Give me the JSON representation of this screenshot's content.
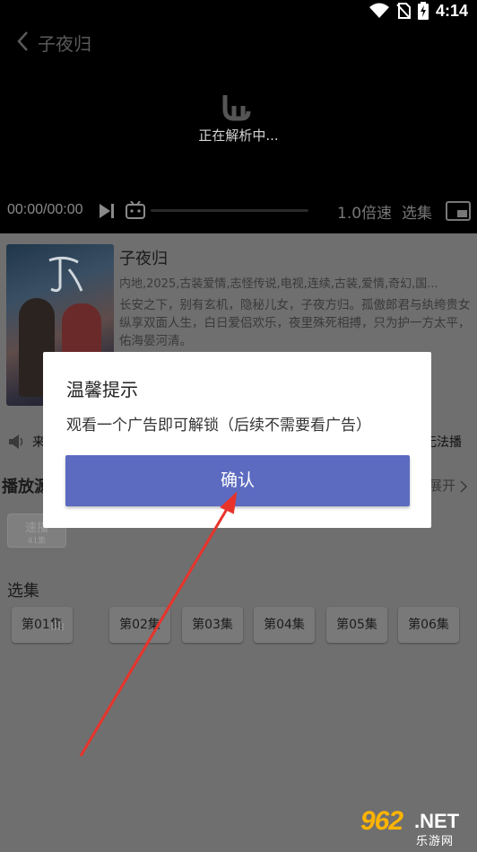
{
  "status_bar": {
    "time": "4:14",
    "icons": [
      "wifi-icon",
      "sim-off-icon",
      "battery-charging-icon"
    ]
  },
  "player": {
    "title": "子夜归",
    "parsing_text": "正在解析中...",
    "timecode": "00:00/00:00",
    "speed_label": "1.0倍速",
    "episodes_label": "选集",
    "icons": [
      "back-icon",
      "loading-icon",
      "play-icon",
      "danmaku-icon",
      "pip-icon"
    ]
  },
  "show": {
    "title": "子夜归",
    "tags": "内地,2025,古装爱情,志怪传说,电视,连续,古装,爱情,奇幻,国...",
    "description": "长安之下，别有玄机，隐秘儿女，子夜方归。孤傲郎君与纨绔贵女纵享双面人生，白日爱侣欢乐，夜里殊死相搏，只为护一方太平，佑海晏河清。"
  },
  "notice": {
    "left_text": "来",
    "right_text": "无法播"
  },
  "source_section": {
    "heading": "播放源",
    "expand_label": "展开",
    "chip": {
      "line1": "速播",
      "line2": "41集"
    }
  },
  "episodes_section": {
    "heading": "选集",
    "items": [
      "第01集",
      "第02集",
      "第03集",
      "第04集",
      "第05集",
      "第06集"
    ]
  },
  "dialog": {
    "title": "温馨提示",
    "message": "观看一个广告即可解锁（后续不需要看广告）",
    "confirm_label": "确认"
  },
  "annotation": {
    "arrow_color": "#e8332b"
  },
  "watermark": {
    "number": "962",
    "net": ".NET",
    "site": "乐游网"
  },
  "colors": {
    "button": "#5c6bc0",
    "dim_overlay": "#6f6f6f"
  }
}
